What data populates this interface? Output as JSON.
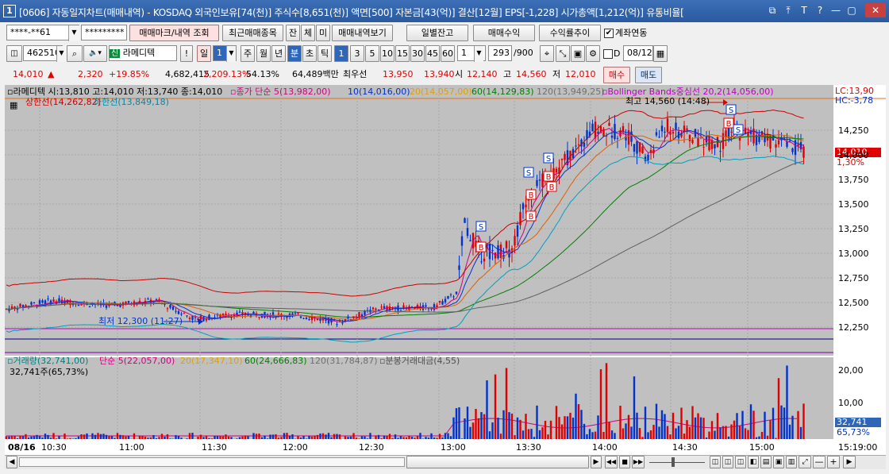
{
  "window": {
    "number": "1",
    "title": "[0606] 자동일지차트(매매내역) - KOSDAQ 외국인보유[74(천)] 주식수[8,651(천)] 액면[500] 자본금[43(억)] 결산[12월] EPS[-1,228] 시가총액[1,212(억)] 유통비율[",
    "buttons": [
      "⧉",
      "⤒",
      "T",
      "?",
      "—",
      "▢",
      "✕"
    ]
  },
  "toolbar1": {
    "account": "****-**61",
    "password": "*********",
    "btn_mark": "매매마크/내역 조회",
    "btn_recent": "최근매매종목",
    "btn_jan": "잔",
    "btn_che": "체",
    "btn_mi": "미",
    "btn_history": "매매내역보기",
    "btn_daily": "일별잔고",
    "btn_profit": "매매수익",
    "btn_rate": "수익률추이",
    "linked_label": "계좌연동",
    "linked_checked": "✔"
  },
  "toolbar2": {
    "code": "462510",
    "stock_badge": "신",
    "stock_name": "라메디텍",
    "exclaim": "!",
    "period_day": "일",
    "period_num": "1",
    "periods": [
      "주",
      "월",
      "년",
      "분",
      "초",
      "틱"
    ],
    "minutes": [
      "1",
      "3",
      "5",
      "10",
      "15",
      "30",
      "45",
      "60"
    ],
    "count_sel": "1",
    "count": "293",
    "total": "/900",
    "d_label": "D",
    "date": "08/12"
  },
  "quote": {
    "price": "14,010",
    "arrow": "▲",
    "change": "2,320",
    "change_pct": "+19.85%",
    "volume": "4,682,415",
    "prev": "2,209.13%",
    "ratio": "54.13%",
    "amount": "64,489백만",
    "best": "최우선",
    "ask": "13,950",
    "bid": "13,940",
    "open_lbl": "시",
    "open": "12,140",
    "high_lbl": "고",
    "high": "14,560",
    "low_lbl": "저",
    "low": "12,010",
    "buy": "매수",
    "sell": "매도"
  },
  "price_pane": {
    "legend1": "라메디텍 시:13,810 고:14,010 저:13,740 종:14,010",
    "legend_ma_prefix": "종가 단순",
    "ma5": "5(13,982,00)",
    "ma10": "10(14,016,00)",
    "ma20": "20(14,057,00)",
    "ma60": "60(14,129,83)",
    "ma120": "120(13,949,25)",
    "bb": "Bollinger Bands중심선 20,2(14,056,00)",
    "upper": "상한선(14,262,82)",
    "lower": "하한선(13,849,18)",
    "high_note": "최고 14,560 (14:48)",
    "low_note": "최저 12,300 (11:27)",
    "lc": "LC:13,90",
    "hc": "HC:-3,78",
    "price_tag": "14,010",
    "pct_tag": "1,30%",
    "y_ticks": [
      "14,250",
      "14,000",
      "13,750",
      "13,500",
      "13,250",
      "13,000",
      "12,750",
      "12,500",
      "12,250"
    ]
  },
  "volume_pane": {
    "legend_vol": "거래량(32,741,00)",
    "legend_prefix": "단순",
    "ma5": "5(22,057,00)",
    "ma20": "20(17,347,10)",
    "ma60": "60(24,666,83)",
    "ma120": "120(31,784,87)",
    "amount": "분봉거래대금(4,55)",
    "sub": "32,741주(65,73%)",
    "y_ticks": [
      "20,00",
      "10,00"
    ],
    "vol_tag": "32,741",
    "vol_pct": "65,73%"
  },
  "x_axis": {
    "date": "08/16",
    "ticks": [
      "10:30",
      "11:00",
      "11:30",
      "12:00",
      "12:30",
      "13:00",
      "13:30",
      "14:00",
      "14:30",
      "15:00"
    ],
    "clock": "15:19:00"
  },
  "colors": {
    "title": "#2a5aa0",
    "up": "#e00000",
    "down": "#0033cc",
    "bb": "#cc0000",
    "ma120": "#808080"
  }
}
